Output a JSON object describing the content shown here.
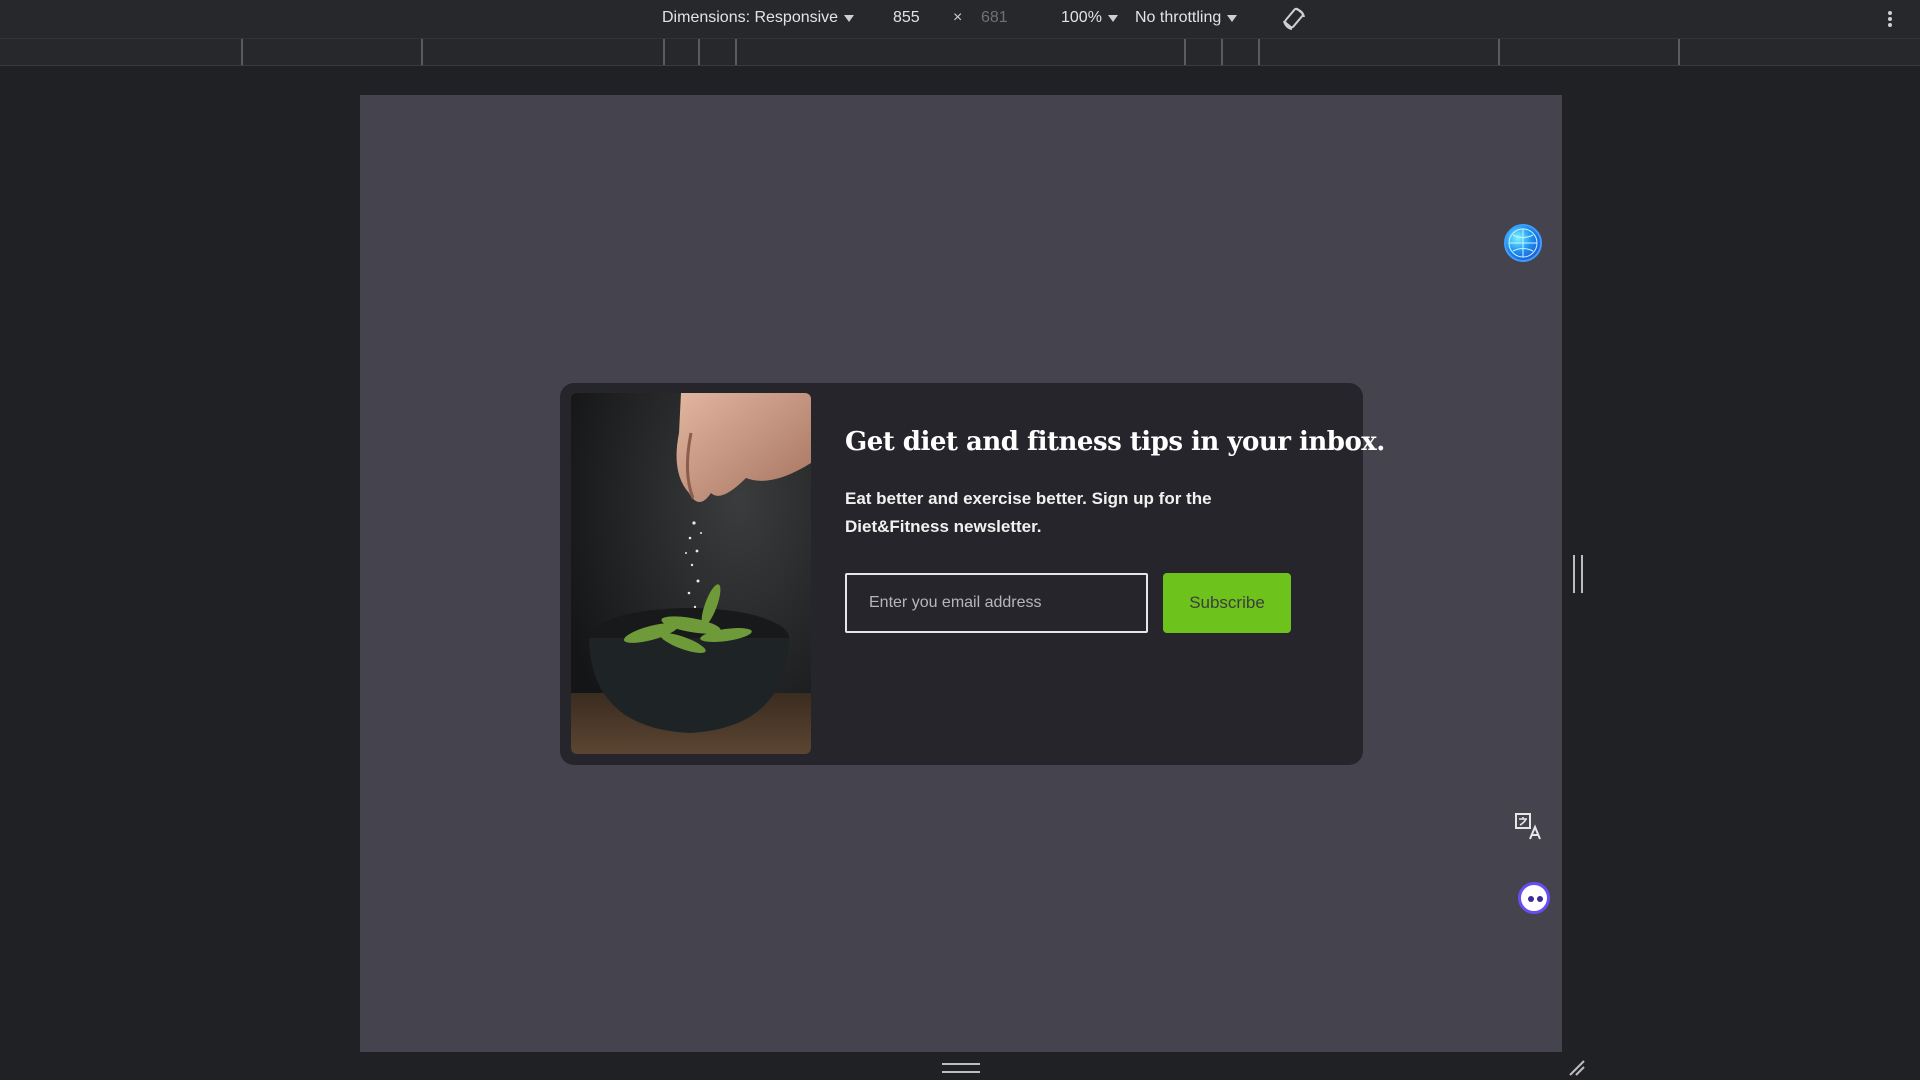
{
  "toolbar": {
    "dimensions_label": "Dimensions: Responsive",
    "width": "855",
    "times": "×",
    "height": "681",
    "zoom": "100%",
    "throttling": "No throttling"
  },
  "newsletter": {
    "headline": "Get diet and fitness tips in your inbox.",
    "description": "Eat better and exercise better. Sign up for the Diet&Fitness newsletter.",
    "email_placeholder": "Enter you email address",
    "subscribe_label": "Subscribe"
  },
  "colors": {
    "viewport_bg": "#45444e",
    "modal_bg": "#26252b",
    "subscribe_green": "#6dc31b"
  },
  "icons": [
    "rotate-icon",
    "more-options-icon",
    "extension-globe-icon",
    "translate-icon",
    "assistant-icon"
  ]
}
